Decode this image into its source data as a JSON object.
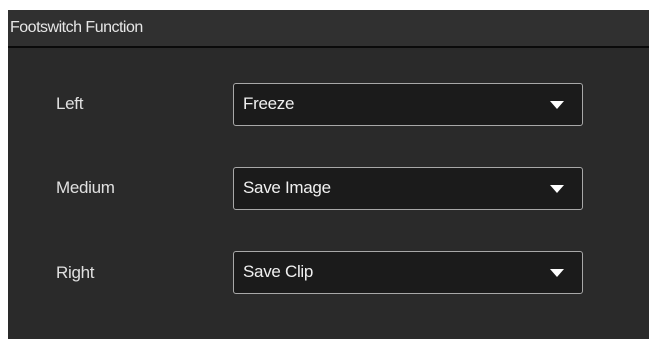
{
  "panel": {
    "title": "Footswitch Function"
  },
  "rows": [
    {
      "label": "Left",
      "value": "Freeze",
      "icon": "dropdown-arrow-icon"
    },
    {
      "label": "Medium",
      "value": "Save Image",
      "icon": "dropdown-arrow-icon"
    },
    {
      "label": "Right",
      "value": "Save Clip",
      "icon": "dropdown-arrow-icon"
    }
  ],
  "colors": {
    "panel_bg": "#2a2a2a",
    "header_bg": "#303030",
    "select_bg": "#1b1b1b",
    "select_border": "#a8a8a8",
    "text": "#e0e0e0"
  }
}
